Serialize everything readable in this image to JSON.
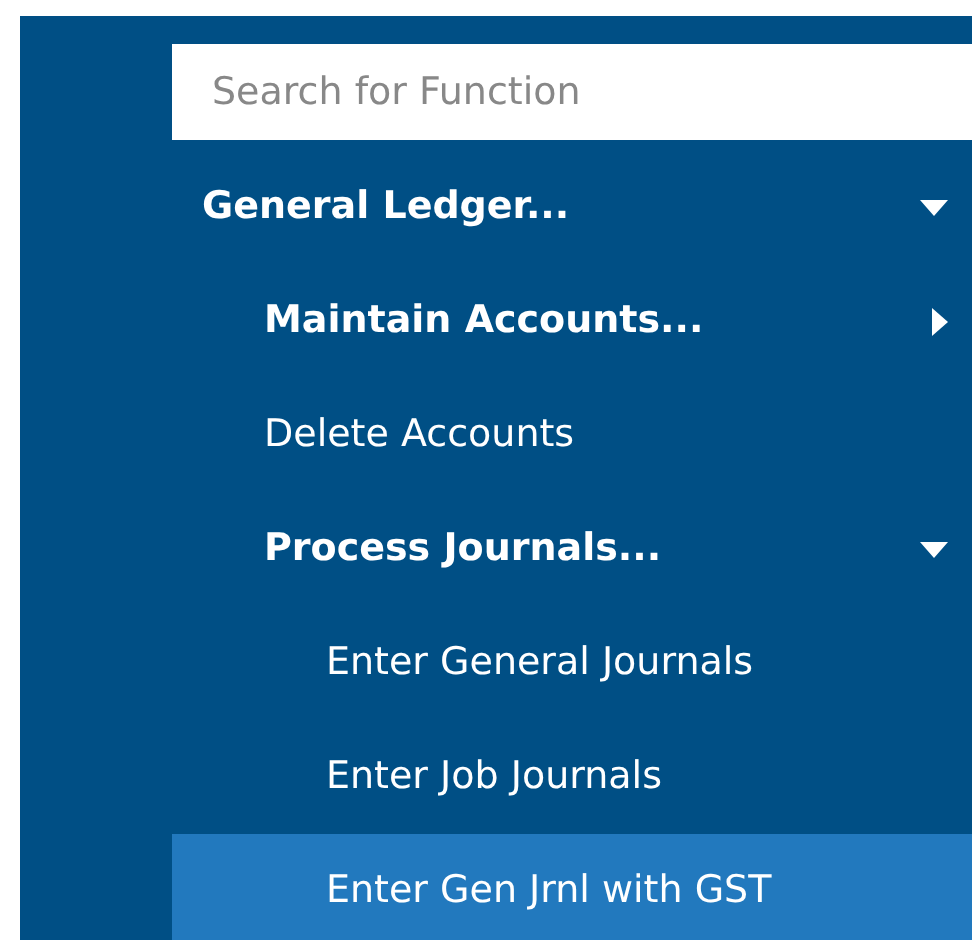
{
  "search": {
    "placeholder": "Search for Function"
  },
  "tree": [
    {
      "label": "General Ledger...",
      "expanded": true,
      "selected": false,
      "children": [
        {
          "label": "Maintain Accounts...",
          "expanded": false,
          "selected": false
        },
        {
          "label": "Delete Accounts",
          "selected": false
        },
        {
          "label": "Process Journals...",
          "expanded": true,
          "selected": false,
          "children": [
            {
              "label": "Enter General Journals",
              "selected": false
            },
            {
              "label": "Enter Job Journals",
              "selected": false
            },
            {
              "label": "Enter Gen Jrnl with GST",
              "selected": true
            }
          ]
        }
      ]
    }
  ]
}
